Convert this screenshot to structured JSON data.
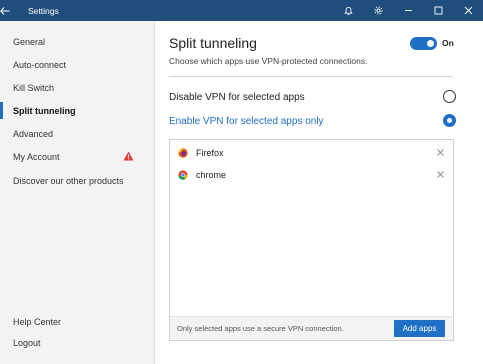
{
  "window": {
    "title": "Settings",
    "icons": [
      "back-arrow-icon",
      "bell-icon",
      "gear-icon",
      "minimize-icon",
      "maximize-icon",
      "close-icon"
    ]
  },
  "sidebar": {
    "items": [
      {
        "label": "General"
      },
      {
        "label": "Auto-connect"
      },
      {
        "label": "Kill Switch"
      },
      {
        "label": "Split tunneling",
        "active": true
      },
      {
        "label": "Advanced"
      },
      {
        "label": "My Account",
        "warning": true
      },
      {
        "label": "Discover our other products"
      }
    ],
    "bottom_items": [
      {
        "label": "Help Center"
      },
      {
        "label": "Logout"
      }
    ]
  },
  "main": {
    "title": "Split tunneling",
    "subtitle": "Choose which apps use VPN-protected connections.",
    "toggle": {
      "state": "On",
      "checked": true
    },
    "options": [
      {
        "label": "Disable VPN for selected apps",
        "selected": false
      },
      {
        "label": "Enable VPN for selected apps only",
        "selected": true
      }
    ],
    "apps": [
      {
        "name": "Firefox",
        "icon": "firefox-icon"
      },
      {
        "name": "chrome",
        "icon": "chrome-icon"
      }
    ],
    "footer_note": "Only selected apps use a secure VPN connection.",
    "add_button": "Add apps"
  },
  "colors": {
    "titlebar": "#1f4e7c",
    "accent": "#1f6fc5",
    "warning": "#e23b3b",
    "sidebar_bg": "#f3f3f3"
  }
}
